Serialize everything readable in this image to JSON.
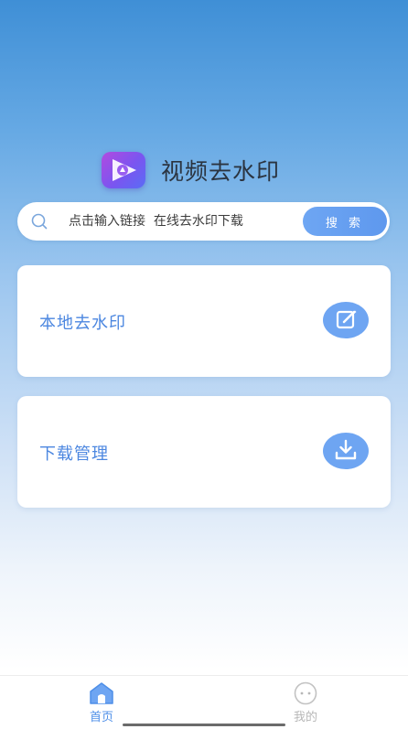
{
  "app": {
    "title": "视频去水印",
    "logo_icon": "video-play-logo-icon"
  },
  "search": {
    "placeholder": "点击输入链接  在线去水印下载",
    "button_label": "搜 索"
  },
  "cards": [
    {
      "label": "本地去水印",
      "icon": "edit-icon"
    },
    {
      "label": "下载管理",
      "icon": "download-icon"
    }
  ],
  "tabbar": {
    "tabs": [
      {
        "label": "首页",
        "icon": "home-icon",
        "active": true
      },
      {
        "label": "我的",
        "icon": "face-icon",
        "active": false
      }
    ]
  },
  "colors": {
    "accent": "#4c87e0",
    "button": "#6ea5f2",
    "inactive": "#b7b7b7"
  }
}
